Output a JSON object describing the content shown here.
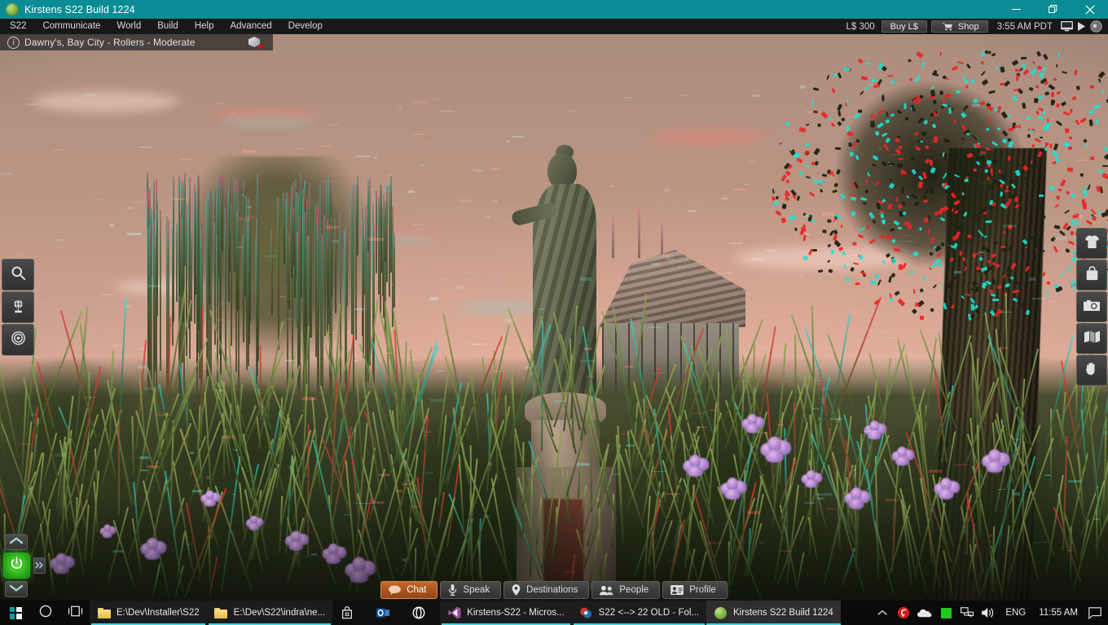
{
  "window": {
    "title": "Kirstens S22 Build 1224",
    "app_icon": "sphere-icon",
    "controls": {
      "minimize": "minimize-icon",
      "restore": "restore-icon",
      "close": "close-icon"
    },
    "titlebar_color": "#0b8c94"
  },
  "menubar": {
    "items": [
      {
        "label": "S22"
      },
      {
        "label": "Communicate"
      },
      {
        "label": "World"
      },
      {
        "label": "Build"
      },
      {
        "label": "Help"
      },
      {
        "label": "Advanced"
      },
      {
        "label": "Develop"
      }
    ],
    "balance": "L$ 300",
    "buy_label": "Buy L$",
    "shop_label": "Shop",
    "shop_icon": "cart-icon",
    "time": "3:55 AM PDT",
    "icons": [
      {
        "name": "monitor-icon"
      },
      {
        "name": "play-arrow-icon"
      },
      {
        "name": "volume-icon"
      }
    ]
  },
  "navbar": {
    "info_icon": "info-icon",
    "location": "Dawny's, Bay City - Rollers - Moderate",
    "parcel_icon": "parcel-cube-icon",
    "parcel_badge": "no-entry-dot"
  },
  "left_rail": [
    {
      "name": "search",
      "icon": "search-icon"
    },
    {
      "name": "world-map",
      "icon": "globe-icon"
    },
    {
      "name": "mini-map",
      "icon": "radar-icon"
    }
  ],
  "right_rail": [
    {
      "name": "appearance",
      "icon": "tshirt-icon"
    },
    {
      "name": "inventory",
      "icon": "bag-icon"
    },
    {
      "name": "snapshot",
      "icon": "camera-icon"
    },
    {
      "name": "map",
      "icon": "map-icon"
    },
    {
      "name": "gestures",
      "icon": "hand-icon"
    }
  ],
  "movement": {
    "up_icon": "chevron-up-icon",
    "down_icon": "chevron-down-icon",
    "power_icon": "power-icon",
    "expand_icon": "double-chevron-right-icon"
  },
  "bottom_toolbar": [
    {
      "label": "Chat",
      "icon": "speech-bubble-icon",
      "active": true
    },
    {
      "label": "Speak",
      "icon": "microphone-icon",
      "active": false
    },
    {
      "label": "Destinations",
      "icon": "map-pin-icon",
      "active": false
    },
    {
      "label": "People",
      "icon": "people-icon",
      "active": false
    },
    {
      "label": "Profile",
      "icon": "profile-card-icon",
      "active": false
    }
  ],
  "taskbar": {
    "start_icon": "windows-logo-icon",
    "system_buttons": [
      {
        "name": "cortana-search",
        "icon": "circle-icon"
      },
      {
        "name": "task-view",
        "icon": "task-view-icon"
      }
    ],
    "tasks": [
      {
        "label": "E:\\Dev\\Installer\\S22",
        "icon": "folder-icon",
        "state": "open"
      },
      {
        "label": "E:\\Dev\\S22\\indra\\ne...",
        "icon": "folder-icon",
        "state": "open"
      },
      {
        "label": "",
        "icon": "store-icon",
        "state": "pinned"
      },
      {
        "label": "",
        "icon": "outlook-icon",
        "state": "pinned"
      },
      {
        "label": "",
        "icon": "opera-icon",
        "state": "pinned"
      },
      {
        "label": "Kirstens-S22 - Micros...",
        "icon": "visual-studio-icon",
        "state": "open"
      },
      {
        "label": "S22 <--> 22 OLD - Fol...",
        "icon": "beyond-compare-icon",
        "state": "open"
      },
      {
        "label": "Kirstens S22 Build 1224",
        "icon": "sphere-icon",
        "state": "active"
      }
    ],
    "tray": {
      "overflow_icon": "chevron-up-icon",
      "icons": [
        {
          "name": "red-circle-icon",
          "color": "#d51b1b"
        },
        {
          "name": "onedrive-cloud-icon",
          "color": "#e8e8e8"
        },
        {
          "name": "green-square-icon",
          "color": "#22c81e"
        },
        {
          "name": "network-icon",
          "color": "#eaeaea"
        },
        {
          "name": "speaker-icon",
          "color": "#eaeaea"
        }
      ],
      "language": "ENG",
      "clock": "11:55 AM",
      "action_center_icon": "speech-bubble-icon"
    }
  },
  "scene": {
    "description": "Second Life virtual world rendered in red/cyan anaglyph 3D stereo",
    "sky_color": "#cfa291",
    "ground_color": "#3a4026",
    "objects": [
      "female-statue-on-pedestal",
      "weeping-willow-tree",
      "large-oak-tree",
      "greenhouse-building",
      "purple-iris-flowers",
      "tall-grass"
    ]
  }
}
